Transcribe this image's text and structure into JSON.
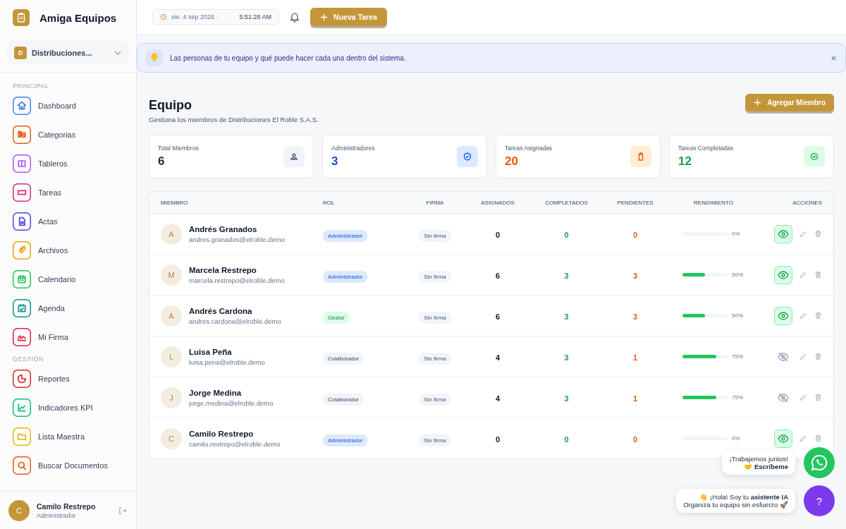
{
  "app": {
    "name": "Amiga Equipos"
  },
  "org": {
    "initial": "D",
    "name": "Distribuciones..."
  },
  "topbar": {
    "date": "vie. 4 sep 2026 ·",
    "time": "5:51:28 AM",
    "new_task": "Nueva Tarea"
  },
  "sidebar": {
    "sections": [
      {
        "title": "PRINCIPAL",
        "items": [
          {
            "label": "Dashboard",
            "color": "#3b82f6"
          },
          {
            "label": "Categorias",
            "color": "#ea580c"
          },
          {
            "label": "Tableros",
            "color": "#a855f7"
          },
          {
            "label": "Tareas",
            "color": "#db2777"
          },
          {
            "label": "Actas",
            "color": "#4f46e5"
          },
          {
            "label": "Archivos",
            "color": "#f59e0b"
          },
          {
            "label": "Calendario",
            "color": "#22c55e"
          },
          {
            "label": "Agenda",
            "color": "#0d9488"
          },
          {
            "label": "Mi Firma",
            "color": "#e11d48"
          }
        ]
      },
      {
        "title": "GESTIÓN",
        "items": [
          {
            "label": "Reportes",
            "color": "#dc2626"
          },
          {
            "label": "Indicadores KPI",
            "color": "#10b981"
          },
          {
            "label": "Lista Maestra",
            "color": "#eab308"
          },
          {
            "label": "Buscar Documentos",
            "color": "#ea580c"
          }
        ]
      }
    ]
  },
  "user": {
    "initial": "C",
    "name": "Camilo Restrepo",
    "role": "Administrador"
  },
  "banner": {
    "text": "Las personas de tu equipo y qué puede hacer cada una dentro del sistema."
  },
  "page": {
    "title": "Equipo",
    "subtitle": "Gestiona los miembros de Distribuciones El Roble S.A.S.",
    "add_button": "Agregar Miembro"
  },
  "stats": [
    {
      "label": "Total Miembros",
      "value": "6",
      "color": "#1f2937"
    },
    {
      "label": "Administradores",
      "value": "3",
      "color": "#1d4ed8"
    },
    {
      "label": "Tareas Asignadas",
      "value": "20",
      "color": "#ea580c"
    },
    {
      "label": "Tareas Completadas",
      "value": "12",
      "color": "#16a34a"
    }
  ],
  "table": {
    "columns": [
      "MIEMBRO",
      "ROL",
      "FIRMA",
      "ASIGNADOS",
      "COMPLETADOS",
      "PENDIENTES",
      "RENDIMIENTO",
      "ACCIONES"
    ],
    "rows": [
      {
        "initial": "A",
        "name": "Andrés Granados",
        "email": "andres.granados@elroble.demo",
        "role": {
          "label": "Administrador",
          "color": "#dbeafe"
        },
        "signature": "Sin firma",
        "assigned": "0",
        "completed": "0",
        "pending": "0",
        "level": 0,
        "percent": "0%",
        "visible": true
      },
      {
        "initial": "M",
        "name": "Marcela Restrepo",
        "email": "marcela.restrepo@elroble.demo",
        "role": {
          "label": "Administrador",
          "color": "#dbeafe"
        },
        "signature": "Sin firma",
        "assigned": "6",
        "completed": "3",
        "pending": "3",
        "level": 0.5,
        "percent": "50%",
        "visible": true
      },
      {
        "initial": "A",
        "name": "Andrés Cardona",
        "email": "andres.cardona@elroble.demo",
        "role": {
          "label": "Gestor",
          "color": "#dcfce7"
        },
        "signature": "Sin firma",
        "assigned": "6",
        "completed": "3",
        "pending": "3",
        "level": 0.5,
        "percent": "50%",
        "visible": true
      },
      {
        "initial": "L",
        "name": "Luisa Peña",
        "email": "luisa.pena@elroble.demo",
        "role": {
          "label": "Colaborador",
          "color": "#f1f5f9"
        },
        "signature": "Sin firma",
        "assigned": "4",
        "completed": "3",
        "pending": "1",
        "level": 0.75,
        "percent": "75%",
        "visible": false
      },
      {
        "initial": "J",
        "name": "Jorge Medina",
        "email": "jorge.medina@elroble.demo",
        "role": {
          "label": "Colaborador",
          "color": "#f1f5f9"
        },
        "signature": "Sin firma",
        "assigned": "4",
        "completed": "3",
        "pending": "1",
        "level": 0.75,
        "percent": "75%",
        "visible": false
      },
      {
        "initial": "C",
        "name": "Camilo Restrepo",
        "email": "camilo.restrepo@elroble.demo",
        "role": {
          "label": "Administrador",
          "color": "#dbeafe"
        },
        "signature": "Sin firma",
        "assigned": "0",
        "completed": "0",
        "pending": "0",
        "level": 0,
        "percent": "0%",
        "visible": true
      }
    ]
  },
  "whatsapp_bubble": {
    "text": "¡Trabajemos juntos!\n🤝 **Escríbeme**"
  },
  "assistant_bubble": {
    "text": "👋 ¡Hola! Soy tu **asistente IA**\nOrganiza tu equipo sin esfuerzo 🚀"
  },
  "help_button": {
    "label": "?"
  }
}
